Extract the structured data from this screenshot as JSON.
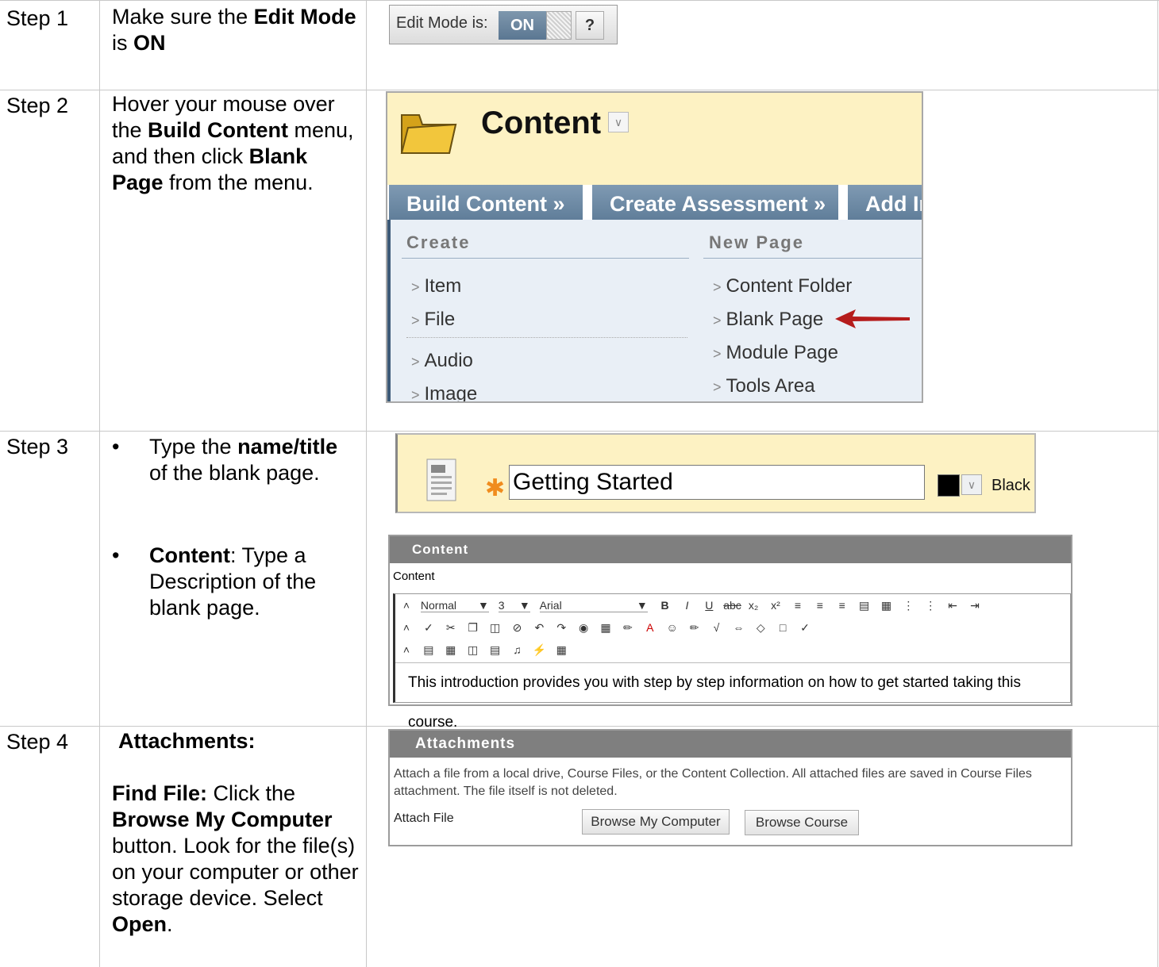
{
  "steps": [
    {
      "label": "Step 1"
    },
    {
      "label": "Step 2"
    },
    {
      "label": "Step 3"
    },
    {
      "label": "Step 4"
    }
  ],
  "step1": {
    "instr": {
      "t1": "Make sure the ",
      "b1": "Edit Mode",
      "t2": " is ",
      "b2": "ON"
    },
    "edit_mode": {
      "label": "Edit Mode is:",
      "state": "ON",
      "help": "?"
    }
  },
  "step2": {
    "instr": {
      "t1": "Hover your mouse over the ",
      "b1": "Build Content",
      "t2": " menu, and then click ",
      "b2": "Blank Page",
      "t3": " from the menu."
    },
    "content_title": "Content",
    "nav": [
      "Build Content",
      "Create Assessment",
      "Add In"
    ],
    "menu": {
      "create_header": "Create",
      "newpage_header": "New Page",
      "create_items": [
        "Item",
        "File",
        "Audio",
        "Image"
      ],
      "newpage_items": [
        "Content Folder",
        "Blank Page",
        "Module Page",
        "Tools Area"
      ]
    }
  },
  "step3": {
    "bullet1": {
      "t1": "Type the ",
      "b1": "name/title",
      "t2": " of the blank page."
    },
    "bullet2": {
      "b1": "Content",
      "t1": ": Type a Description of the blank page."
    },
    "name_value": "Getting Started",
    "color_label": "Black",
    "editor": {
      "header": "Content",
      "label": "Content",
      "style": "Normal",
      "size": "3",
      "font": "Arial",
      "body_text": "This introduction provides you with step by step information on how to get started taking this course."
    }
  },
  "step4": {
    "instr": {
      "h": "Attachments:",
      "b1": "Find File:",
      "t1": " Click the ",
      "b2": "Browse My Computer",
      "t2": " button. Look for the file(s) on your computer or other storage device. Select ",
      "b3": "Open",
      "t3": "."
    },
    "attach": {
      "header": "Attachments",
      "desc1": "Attach a file from a local drive, Course Files, or the Content Collection. All attached files are saved in Course Files",
      "desc2": "attachment. The file itself is not deleted.",
      "attach_file": "Attach File",
      "browse_computer": "Browse My Computer",
      "browse_course": "Browse Course"
    }
  }
}
